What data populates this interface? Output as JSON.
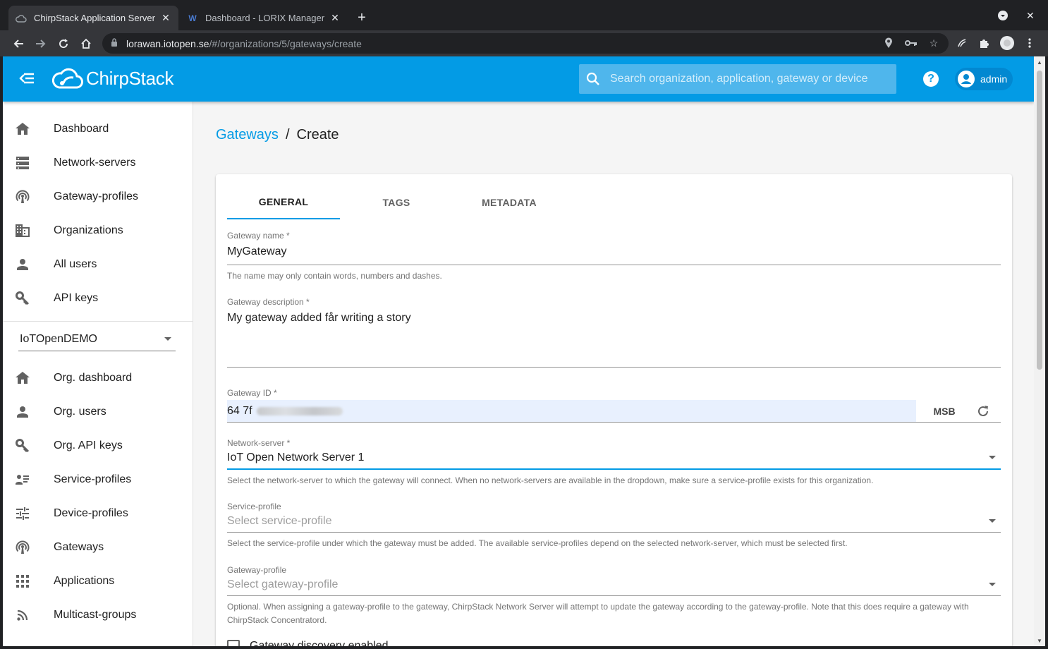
{
  "browser": {
    "tabs": [
      {
        "title": "ChirpStack Application Server",
        "close": "✕"
      },
      {
        "title": "Dashboard - LORIX Manager",
        "close": "✕"
      }
    ],
    "new_tab": "+",
    "url_host": "lorawan.iotopen.se",
    "url_path": "/#/organizations/5/gateways/create"
  },
  "header": {
    "logo_text": "ChirpStack",
    "search_placeholder": "Search organization, application, gateway or device",
    "help": "?",
    "user": "admin"
  },
  "sidebar": {
    "global_items": [
      {
        "label": "Dashboard",
        "icon": "home-icon"
      },
      {
        "label": "Network-servers",
        "icon": "server-icon"
      },
      {
        "label": "Gateway-profiles",
        "icon": "radio-tower-icon"
      },
      {
        "label": "Organizations",
        "icon": "domain-icon"
      },
      {
        "label": "All users",
        "icon": "account-icon"
      },
      {
        "label": "API keys",
        "icon": "key-icon"
      }
    ],
    "org_selected": "IoTOpenDEMO",
    "org_items": [
      {
        "label": "Org. dashboard",
        "icon": "home-icon"
      },
      {
        "label": "Org. users",
        "icon": "account-icon"
      },
      {
        "label": "Org. API keys",
        "icon": "key-icon"
      },
      {
        "label": "Service-profiles",
        "icon": "account-details-icon"
      },
      {
        "label": "Device-profiles",
        "icon": "tune-icon"
      },
      {
        "label": "Gateways",
        "icon": "radio-tower-icon"
      },
      {
        "label": "Applications",
        "icon": "apps-icon"
      },
      {
        "label": "Multicast-groups",
        "icon": "rss-icon"
      }
    ]
  },
  "breadcrumb": {
    "parent": "Gateways",
    "separator": "/",
    "current": "Create"
  },
  "tabs": [
    "GENERAL",
    "TAGS",
    "METADATA"
  ],
  "form": {
    "name": {
      "label": "Gateway name *",
      "value": "MyGateway",
      "help": "The name may only contain words, numbers and dashes."
    },
    "description": {
      "label": "Gateway description *",
      "value": "My gateway added får writing a story"
    },
    "gateway_id": {
      "label": "Gateway ID *",
      "value": "64 7f",
      "byte_order": "MSB"
    },
    "network_server": {
      "label": "Network-server *",
      "value": "IoT Open Network Server 1",
      "help": "Select the network-server to which the gateway will connect. When no network-servers are available in the dropdown, make sure a service-profile exists for this organization."
    },
    "service_profile": {
      "label": "Service-profile",
      "placeholder": "Select service-profile",
      "help": "Select the service-profile under which the gateway must be added. The available service-profiles depend on the selected network-server, which must be selected first."
    },
    "gateway_profile": {
      "label": "Gateway-profile",
      "placeholder": "Select gateway-profile",
      "help": "Optional. When assigning a gateway-profile to the gateway, ChirpStack Network Server will attempt to update the gateway according to the gateway-profile. Note that this does require a gateway with ChirpStack Concentratord."
    },
    "discovery": {
      "label": "Gateway discovery enabled"
    }
  },
  "colors": {
    "primary": "#039be5",
    "autofill": "#e8f0fe"
  }
}
